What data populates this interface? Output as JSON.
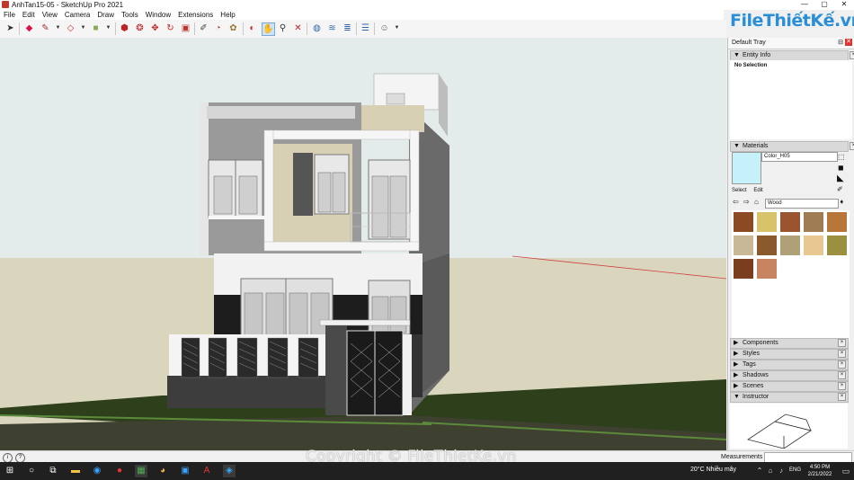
{
  "window": {
    "title": "AnhTan15-05 - SketchUp Pro 2021",
    "controls": [
      "—",
      "▢",
      "✕"
    ]
  },
  "menu": [
    "File",
    "Edit",
    "View",
    "Camera",
    "Draw",
    "Tools",
    "Window",
    "Extensions",
    "Help"
  ],
  "logo": {
    "text": "FileThiếtKế.vn"
  },
  "toolbar": {
    "icons": [
      "select-icon",
      "eraser-icon",
      "pencil-icon",
      "dropdown-arrow-icon",
      "shape-icon",
      "dropdown-arrow-icon",
      "paint-bucket-icon",
      "dropdown-arrow-icon",
      "push-pull-icon",
      "follow-me-icon",
      "move-icon",
      "rotate-icon",
      "scale-icon",
      "tape-measure-icon",
      "protractor-icon",
      "paint-icon",
      "orbit-icon",
      "pan-icon",
      "zoom-icon",
      "zoom-extents-icon",
      "section-plane-icon",
      "section-fill-icon",
      "layers-icon",
      "styles-icon",
      "user-icon",
      "dropdown-arrow-icon"
    ]
  },
  "tray": {
    "title": "Default Tray",
    "entity_info": {
      "label": "Entity Info",
      "value": "No Selection"
    },
    "materials": {
      "label": "Materials",
      "current_name": "Color_H05",
      "current_color": "#c6f1fb",
      "tabs": [
        "Select",
        "Edit"
      ],
      "collection": "Wood",
      "swatches": [
        "#8b4a24",
        "#d9c36a",
        "#9a5530",
        "#a07c54",
        "#b8763a",
        "#c8b898",
        "#8a5a2c",
        "#b0a078",
        "#e8c890",
        "#9a9040",
        "#7a3e1e",
        "#c88460"
      ]
    },
    "collapsed_panels": [
      "Components",
      "Styles",
      "Tags",
      "Shadows",
      "Scenes",
      "Instructor"
    ]
  },
  "status": {
    "measurements_label": "Measurements"
  },
  "watermark": "Copyright © FileThietKe.vn",
  "taskbar": {
    "weather": "20°C  Nhiều mây",
    "lang": "ENG",
    "time": "4:50 PM",
    "date": "2/21/2022"
  }
}
